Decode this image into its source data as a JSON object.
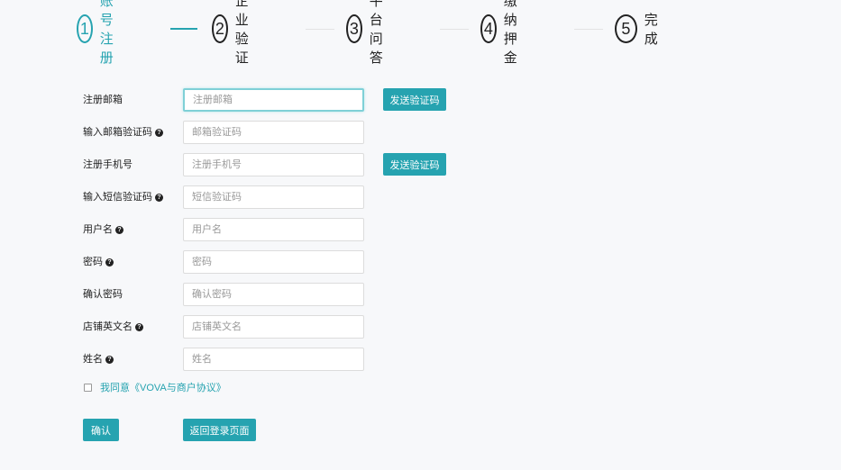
{
  "steps": [
    {
      "number": "1",
      "label": "账号注册",
      "active": true
    },
    {
      "number": "2",
      "label": "企业验证",
      "active": false
    },
    {
      "number": "3",
      "label": "平台问答",
      "active": false
    },
    {
      "number": "4",
      "label": "缴纳押金",
      "active": false
    },
    {
      "number": "5",
      "label": "完成",
      "active": false
    }
  ],
  "form": {
    "email": {
      "label": "注册邮箱",
      "placeholder": "注册邮箱",
      "value": ""
    },
    "email_code": {
      "label": "输入邮箱验证码",
      "placeholder": "邮箱验证码",
      "value": ""
    },
    "phone": {
      "label": "注册手机号",
      "placeholder": "注册手机号",
      "value": ""
    },
    "sms_code": {
      "label": "输入短信验证码",
      "placeholder": "短信验证码",
      "value": ""
    },
    "username": {
      "label": "用户名",
      "placeholder": "用户名",
      "value": ""
    },
    "password": {
      "label": "密码",
      "placeholder": "密码",
      "value": ""
    },
    "confirm_password": {
      "label": "确认密码",
      "placeholder": "确认密码",
      "value": ""
    },
    "store_name_en": {
      "label": "店铺英文名",
      "placeholder": "店铺英文名",
      "value": ""
    },
    "name": {
      "label": "姓名",
      "placeholder": "姓名",
      "value": ""
    },
    "send_code_label": "发送验证码",
    "help_glyph": "?",
    "agreement": "我同意《VOVA与商户协议》",
    "agreement_checked": false
  },
  "actions": {
    "confirm_label": "确认",
    "back_label": "返回登录页面"
  },
  "colors": {
    "accent": "#26a3b0",
    "text": "#222222",
    "placeholder": "#999999",
    "background": "#f7f8fa"
  }
}
